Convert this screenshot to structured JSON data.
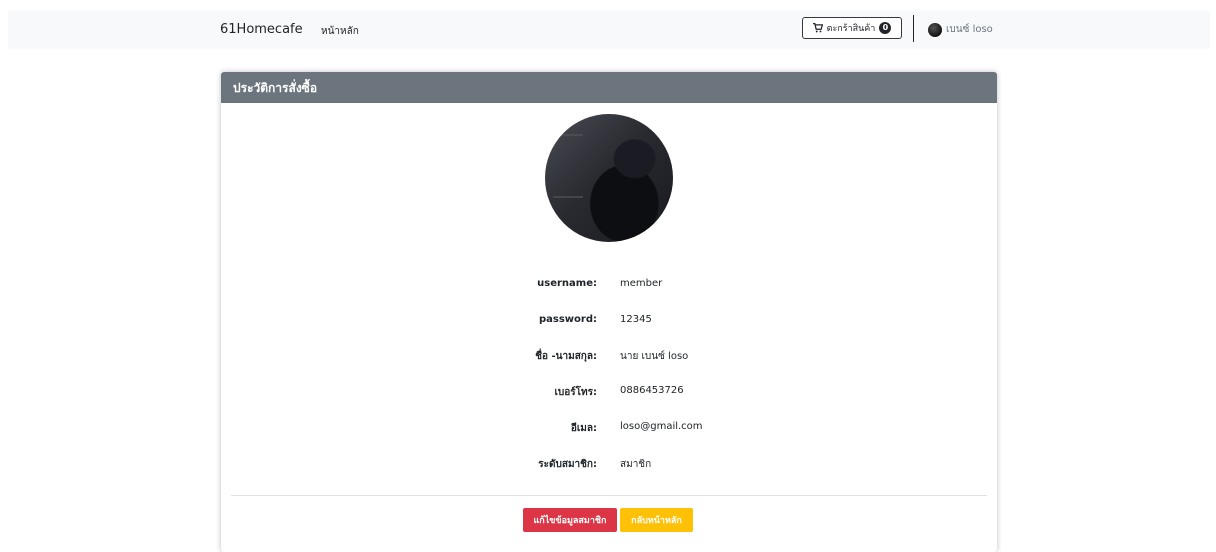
{
  "navbar": {
    "brand": "61Homecafe",
    "home_link": "หน้าหลัก",
    "cart": {
      "label": "ตะกร้าสินค้า",
      "count": "0"
    },
    "user": {
      "name": "เบนซ์ loso"
    }
  },
  "card": {
    "header": "ประวัติการสั่งซื้อ",
    "fields": [
      {
        "label": "username:",
        "value": "member"
      },
      {
        "label": "password:",
        "value": "12345"
      },
      {
        "label": "ชื่อ -นามสกุล:",
        "value": "นาย เบนซ์ loso"
      },
      {
        "label": "เบอร์โทร:",
        "value": "0886453726"
      },
      {
        "label": "อีเมล:",
        "value": "loso@gmail.com"
      },
      {
        "label": "ระดับสมาชิก:",
        "value": "สมาชิก"
      }
    ],
    "buttons": {
      "edit": "แก้ไขข้อมูลสมาชิก",
      "back": "กลับหน้าหลัก"
    }
  },
  "colors": {
    "header_bg": "#6c757d",
    "danger": "#dc3545",
    "warning": "#ffc107",
    "navbar_bg": "#f8f9fa"
  }
}
